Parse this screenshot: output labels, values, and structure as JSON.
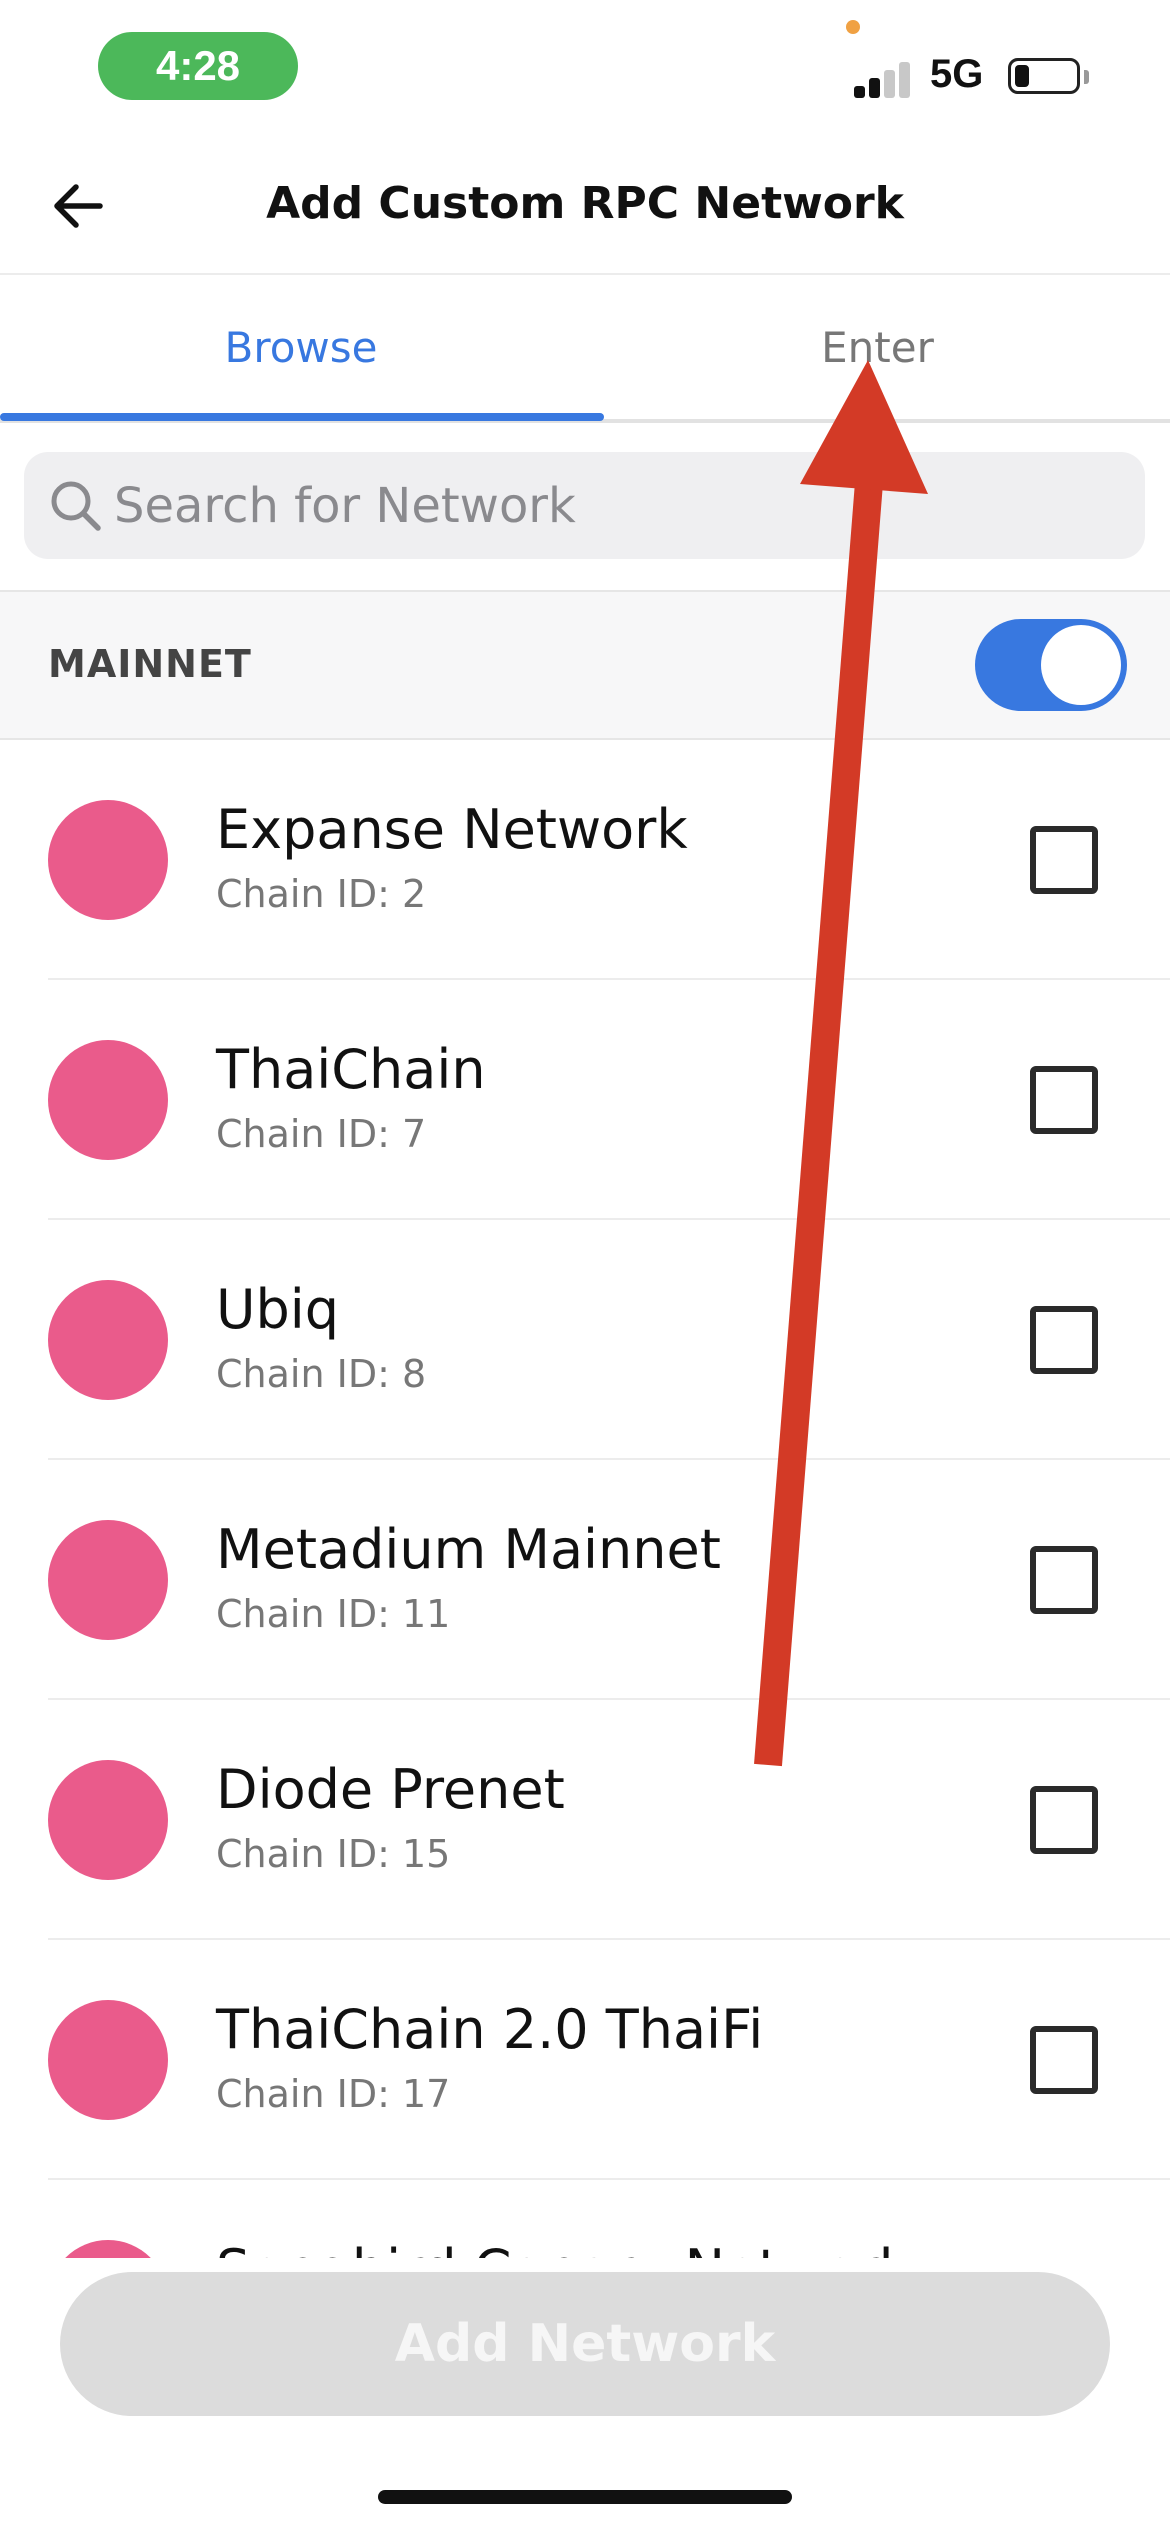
{
  "status_bar": {
    "time": "4:28",
    "network": "5G",
    "battery_level": 0.2
  },
  "header": {
    "title": "Add Custom RPC Network"
  },
  "tabs": [
    {
      "label": "Browse",
      "active": true
    },
    {
      "label": "Enter",
      "active": false
    }
  ],
  "search": {
    "placeholder": "Search for Network",
    "value": ""
  },
  "section": {
    "label": "MAINNET",
    "toggle_on": true
  },
  "networks": [
    {
      "name": "Expanse Network",
      "chain": "Chain ID: 2",
      "checked": false
    },
    {
      "name": "ThaiChain",
      "chain": "Chain ID: 7",
      "checked": false
    },
    {
      "name": "Ubiq",
      "chain": "Chain ID: 8",
      "checked": false
    },
    {
      "name": "Metadium Mainnet",
      "chain": "Chain ID: 11",
      "checked": false
    },
    {
      "name": "Diode Prenet",
      "chain": "Chain ID: 15",
      "checked": false
    },
    {
      "name": "ThaiChain 2.0 ThaiFi",
      "chain": "Chain ID: 17",
      "checked": false
    },
    {
      "name": "Songbird Canary-Network",
      "chain": "",
      "checked": false
    }
  ],
  "footer": {
    "add_button": "Add Network"
  },
  "colors": {
    "accent": "#3878e0",
    "network_logo": "#ea5b8b",
    "time_pill": "#4cb85a",
    "annotation_arrow": "#d33a26",
    "disabled_button": "#dcdcdc"
  },
  "icons": {
    "back": "arrow-left-icon",
    "search": "search-icon",
    "checkbox": "checkbox-unchecked-icon"
  }
}
